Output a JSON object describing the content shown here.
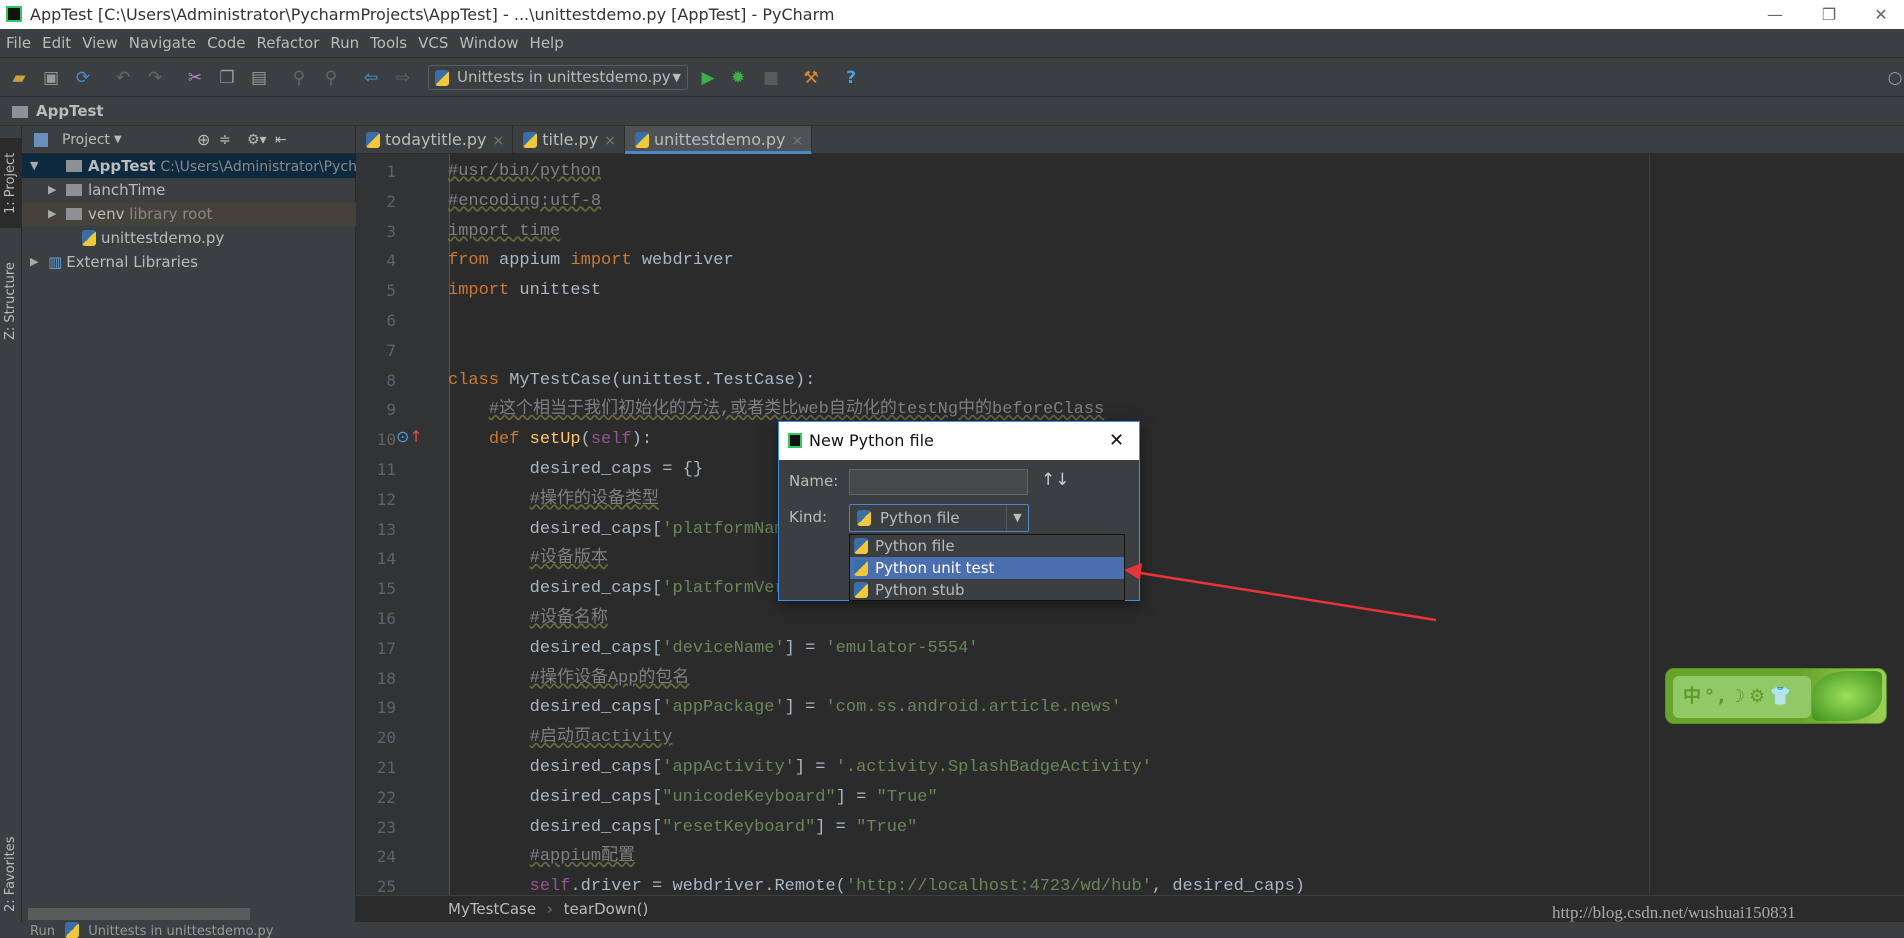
{
  "window": {
    "title": "AppTest [C:\\Users\\Administrator\\PycharmProjects\\AppTest] - ...\\unittestdemo.py [AppTest] - PyCharm",
    "minimize": "—",
    "restore": "❐",
    "close": "✕"
  },
  "menu": [
    "File",
    "Edit",
    "View",
    "Navigate",
    "Code",
    "Refactor",
    "Run",
    "Tools",
    "VCS",
    "Window",
    "Help"
  ],
  "toolbar": {
    "run_config": "Unittests in unittestdemo.py",
    "help": "?"
  },
  "navbar": {
    "project": "AppTest"
  },
  "side_tabs": {
    "project": "1: Project",
    "structure": "Z: Structure",
    "favorites": "2: Favorites"
  },
  "project_panel": {
    "title": "Project",
    "tree": [
      {
        "label": "AppTest",
        "extra": "C:\\Users\\Administrator\\Pych",
        "type": "folder",
        "expanded": true
      },
      {
        "label": "lanchTime",
        "extra": "",
        "type": "folder"
      },
      {
        "label": "venv",
        "extra": "library root",
        "type": "folder"
      },
      {
        "label": "unittestdemo.py",
        "extra": "",
        "type": "python-file"
      },
      {
        "label": "External Libraries",
        "extra": "",
        "type": "libraries"
      }
    ]
  },
  "tabs": [
    {
      "label": "todaytitle.py",
      "close": "×"
    },
    {
      "label": "title.py",
      "close": "×"
    },
    {
      "label": "unittestdemo.py",
      "close": "×",
      "active": true
    }
  ],
  "code": [
    [
      [
        "#usr/bin/python",
        "c"
      ]
    ],
    [
      [
        "#encoding:utf-8",
        "c"
      ]
    ],
    [
      [
        "import time",
        "c"
      ]
    ],
    [
      [
        "from",
        "k"
      ],
      [
        " appium ",
        ""
      ],
      [
        "import",
        "k"
      ],
      [
        " webdriver",
        ""
      ]
    ],
    [
      [
        "import",
        "k"
      ],
      [
        " unittest",
        ""
      ]
    ],
    [],
    [],
    [
      [
        "class",
        "k"
      ],
      [
        " MyTestCase(unittest.TestCase):",
        ""
      ]
    ],
    [
      [
        "    ",
        ""
      ],
      [
        "#这个相当于我们初始化的方法,或者类比web自动化的testNg中的beforeClass",
        "c"
      ]
    ],
    [
      [
        "    ",
        ""
      ],
      [
        "def",
        "k"
      ],
      [
        " ",
        ""
      ],
      [
        "setUp",
        "f"
      ],
      [
        "(",
        ""
      ],
      [
        "self",
        "p"
      ],
      [
        "):",
        ""
      ]
    ],
    [
      [
        "        desired_caps = {}",
        ""
      ]
    ],
    [
      [
        "        ",
        ""
      ],
      [
        "#操作的设备类型",
        "c"
      ]
    ],
    [
      [
        "        desired_caps[",
        ""
      ],
      [
        "'platformNam",
        "s"
      ]
    ],
    [
      [
        "        ",
        ""
      ],
      [
        "#设备版本",
        "c"
      ]
    ],
    [
      [
        "        desired_caps[",
        ""
      ],
      [
        "'platformVer",
        "s"
      ]
    ],
    [
      [
        "        ",
        ""
      ],
      [
        "#设备名称",
        "c"
      ]
    ],
    [
      [
        "        desired_caps[",
        ""
      ],
      [
        "'deviceName'",
        "s"
      ],
      [
        "] = ",
        ""
      ],
      [
        "'emulator-5554'",
        "s"
      ]
    ],
    [
      [
        "        ",
        ""
      ],
      [
        "#操作设备App的包名",
        "c"
      ]
    ],
    [
      [
        "        desired_caps[",
        ""
      ],
      [
        "'appPackage'",
        "s"
      ],
      [
        "] = ",
        ""
      ],
      [
        "'com.ss.android.article.news'",
        "s"
      ]
    ],
    [
      [
        "        ",
        ""
      ],
      [
        "#启动页activity",
        "c"
      ]
    ],
    [
      [
        "        desired_caps[",
        ""
      ],
      [
        "'appActivity'",
        "s"
      ],
      [
        "] = ",
        ""
      ],
      [
        "'.activity.SplashBadgeActivity'",
        "s"
      ]
    ],
    [
      [
        "        desired_caps[",
        ""
      ],
      [
        "\"unicodeKeyboard\"",
        "s"
      ],
      [
        "] = ",
        ""
      ],
      [
        "\"True\"",
        "s"
      ]
    ],
    [
      [
        "        desired_caps[",
        ""
      ],
      [
        "\"resetKeyboard\"",
        "s"
      ],
      [
        "] = ",
        ""
      ],
      [
        "\"True\"",
        "s"
      ]
    ],
    [
      [
        "        ",
        ""
      ],
      [
        "#appium配置",
        "c"
      ]
    ],
    [
      [
        "        ",
        ""
      ],
      [
        "self",
        "p"
      ],
      [
        ".driver = webdriver.Remote(",
        ""
      ],
      [
        "'http://localhost:4723/wd/hub'",
        "s"
      ],
      [
        ", desired_caps)",
        ""
      ]
    ]
  ],
  "editor_breadcrumb": {
    "class": "MyTestCase",
    "sep": "›",
    "method": "tearDown()"
  },
  "bottom_bar": {
    "label": "Run",
    "config": "Unittests in unittestdemo.py"
  },
  "dialog": {
    "title": "New Python file",
    "close": "✕",
    "name_label": "Name:",
    "name_value": "",
    "sort_icon": "↑↓",
    "kind_label": "Kind:",
    "kind_value": "Python file",
    "options": [
      "Python file",
      "Python unit test",
      "Python stub"
    ],
    "selected_option": "Python unit test"
  },
  "ime": {
    "text": "中°,☽⚙👕"
  },
  "watermark": "http://blog.csdn.net/wushuai150831",
  "colors": {
    "annotation_arrow": "#e8333a",
    "selection": "#4b6eaf",
    "accent": "#4a88c7"
  }
}
